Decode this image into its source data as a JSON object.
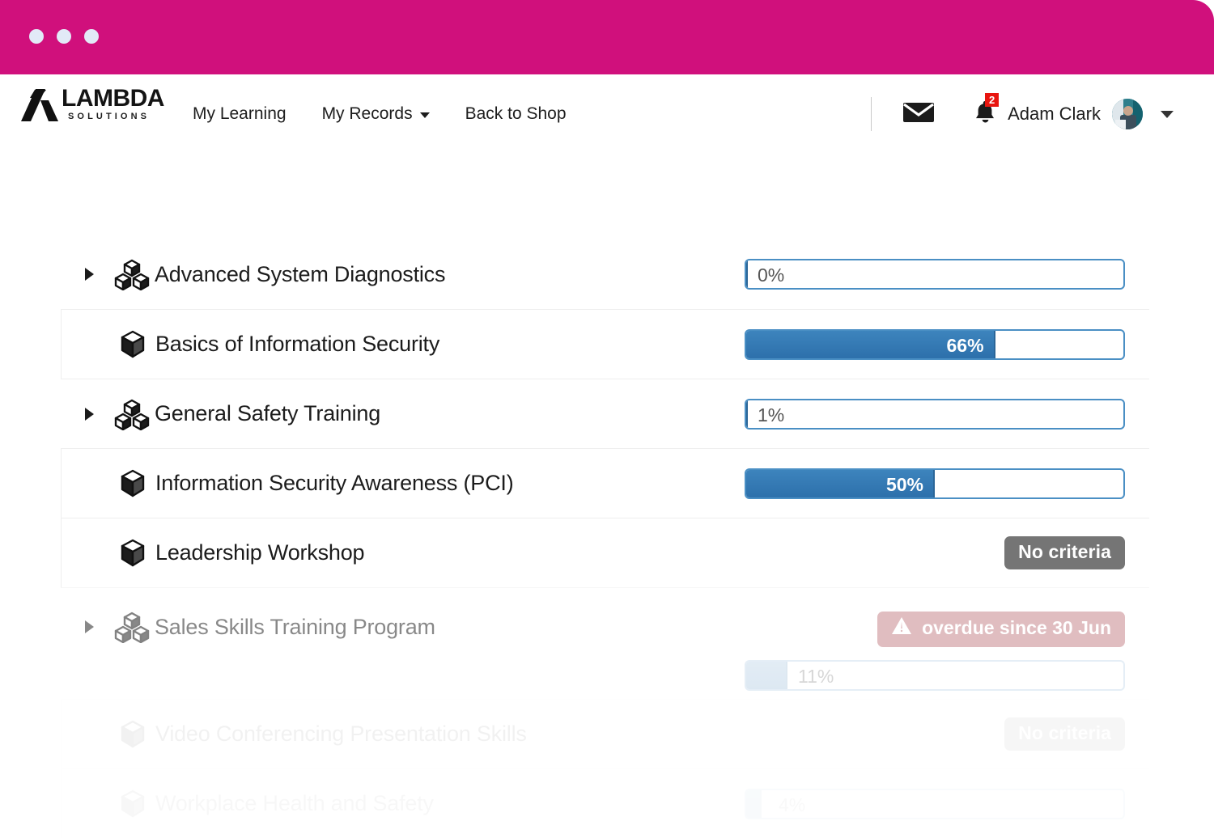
{
  "window": {
    "accent_color": "#d0107c",
    "dots": [
      "dot-1",
      "dot-2",
      "dot-3"
    ]
  },
  "header": {
    "logo": {
      "name": "LAMBDA",
      "tagline": "SOLUTIONS",
      "mark": "lambda-arrow-mark"
    },
    "nav": [
      {
        "label": "My Learning",
        "has_dropdown": false
      },
      {
        "label": "My Records",
        "has_dropdown": true
      },
      {
        "label": "Back to Shop",
        "has_dropdown": false
      }
    ],
    "mail_icon": "envelope-icon",
    "notifications": {
      "icon": "bell-icon",
      "count": "2",
      "badge_color": "#e8150f"
    },
    "user": {
      "name": "Adam Clark",
      "avatar": "user-avatar",
      "menu_icon": "caret-down-icon"
    }
  },
  "course_list": {
    "rows": [
      {
        "title": "Advanced System Diagnostics",
        "icon": "program-cubes-icon",
        "expandable": true,
        "indent": false,
        "status": {
          "type": "progress",
          "percent": 0,
          "label": "0%"
        }
      },
      {
        "title": "Basics of Information Security",
        "icon": "course-cube-icon",
        "expandable": false,
        "indent": true,
        "status": {
          "type": "progress",
          "percent": 66,
          "label": "66%"
        }
      },
      {
        "title": "General Safety Training",
        "icon": "program-cubes-icon",
        "expandable": true,
        "indent": false,
        "status": {
          "type": "progress",
          "percent": 1,
          "label": "1%"
        }
      },
      {
        "title": "Information Security Awareness (PCI)",
        "icon": "course-cube-icon",
        "expandable": false,
        "indent": true,
        "status": {
          "type": "progress",
          "percent": 50,
          "label": "50%"
        }
      },
      {
        "title": "Leadership Workshop",
        "icon": "course-cube-icon",
        "expandable": false,
        "indent": true,
        "status": {
          "type": "badge",
          "label": "No criteria",
          "color": "#757575"
        }
      },
      {
        "title": "Sales Skills Training Program",
        "icon": "program-cubes-icon",
        "expandable": true,
        "indent": false,
        "status": {
          "type": "overdue",
          "badge_label": "overdue since 30 Jun",
          "badge_icon": "warning-triangle-icon",
          "badge_color": "#c58288",
          "percent": 11,
          "label": "11%"
        }
      },
      {
        "title": "Video Conferencing Presentation Skills",
        "icon": "course-cube-icon",
        "expandable": false,
        "indent": true,
        "status": {
          "type": "badge",
          "label": "No criteria",
          "color": "#757575"
        }
      },
      {
        "title": "Workplace Health and Safety",
        "icon": "course-cube-icon",
        "expandable": false,
        "indent": true,
        "status": {
          "type": "progress",
          "percent": 4,
          "label": "4%"
        }
      }
    ]
  }
}
